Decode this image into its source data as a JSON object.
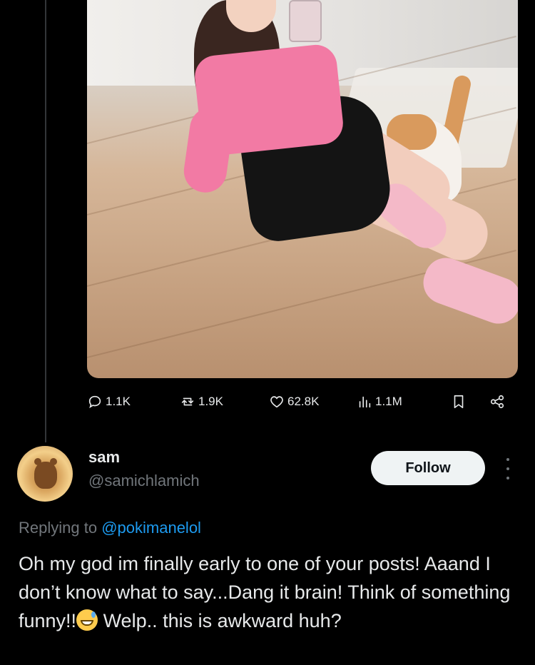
{
  "post": {
    "metrics": {
      "replies": "1.1K",
      "reposts": "1.9K",
      "likes": "62.8K",
      "views": "1.1M"
    }
  },
  "reply": {
    "display_name": "sam",
    "handle": "@samichlamich",
    "follow_label": "Follow",
    "replying_prefix": "Replying to",
    "replying_to": "@pokimanelol",
    "text_before_emoji": "Oh my god im finally early to one of your posts! Aaand I don’t know what to say...Dang it brain! Think of something funny!!",
    "text_after_emoji": " Welp.. this is awkward huh?"
  },
  "icons": {
    "reply": "comment-icon",
    "repost": "repost-icon",
    "like": "heart-icon",
    "views": "analytics-icon",
    "bookmark": "bookmark-icon",
    "share": "share-icon",
    "more": "more-vertical-icon"
  },
  "colors": {
    "background": "#000000",
    "text": "#e7e9ea",
    "muted": "#71767b",
    "link": "#1d9bf0",
    "follow_bg": "#eff3f4"
  }
}
